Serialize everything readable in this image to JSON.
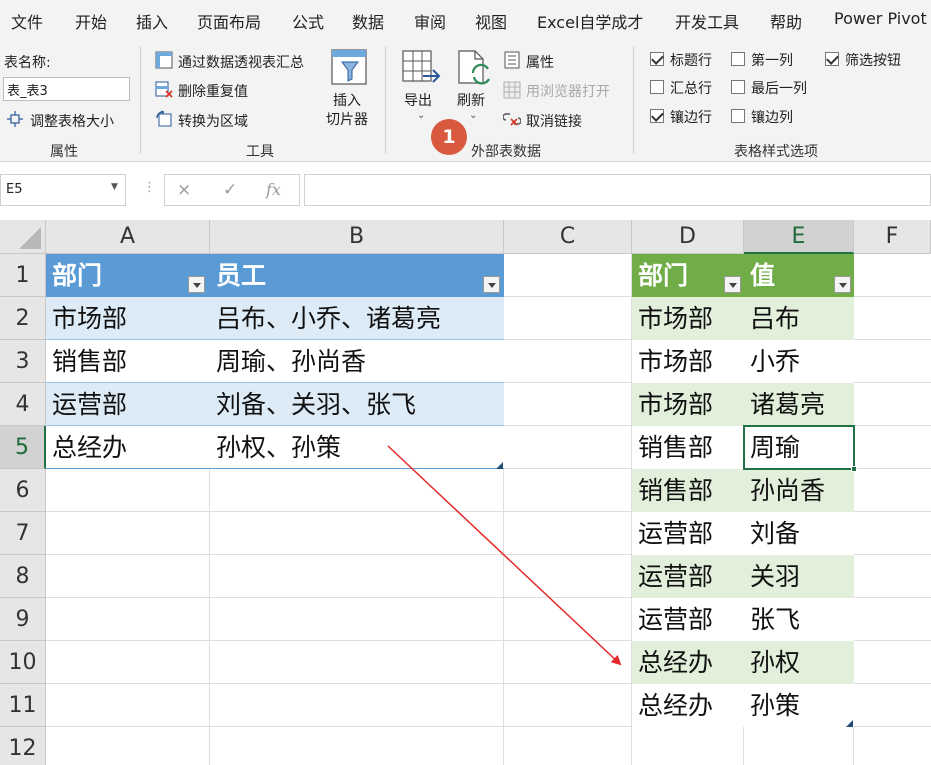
{
  "menu": {
    "tabs": [
      "文件",
      "开始",
      "插入",
      "页面布局",
      "公式",
      "数据",
      "审阅",
      "视图",
      "Excel自学成才",
      "开发工具",
      "帮助",
      "Power Pivot"
    ]
  },
  "ribbon": {
    "properties": {
      "table_name_label": "表名称:",
      "table_name_value": "表_表3",
      "resize_label": "调整表格大小",
      "group_label": "属性"
    },
    "tools": {
      "pivot_label": "通过数据透视表汇总",
      "remove_dup_label": "删除重复值",
      "convert_label": "转换为区域",
      "slicer_label_1": "插入",
      "slicer_label_2": "切片器",
      "group_label": "工具"
    },
    "external": {
      "export_label": "导出",
      "refresh_label": "刷新",
      "properties_label": "属性",
      "open_browser_label": "用浏览器打开",
      "unlink_label": "取消链接",
      "group_label": "外部表数据",
      "badge": "1"
    },
    "style_options": {
      "header_row": "标题行",
      "total_row": "汇总行",
      "banded_rows": "镶边行",
      "first_column": "第一列",
      "last_column": "最后一列",
      "banded_columns": "镶边列",
      "filter_button": "筛选按钮",
      "group_label": "表格样式选项",
      "checked": {
        "header_row": true,
        "total_row": false,
        "banded_rows": true,
        "first_column": false,
        "last_column": false,
        "banded_columns": false,
        "filter_button": true
      }
    }
  },
  "formula_bar": {
    "name_box": "E5",
    "cancel_icon": "×",
    "enter_icon": "✓",
    "fx_icon": "fx",
    "formula": ""
  },
  "grid": {
    "columns": [
      "A",
      "B",
      "C",
      "D",
      "E",
      "F"
    ],
    "rows": [
      "1",
      "2",
      "3",
      "4",
      "5",
      "6",
      "7",
      "8",
      "9",
      "10",
      "11",
      "12"
    ],
    "table1": {
      "headers": [
        "部门",
        "员工"
      ],
      "rows": [
        [
          "市场部",
          "吕布、小乔、诸葛亮"
        ],
        [
          "销售部",
          "周瑜、孙尚香"
        ],
        [
          "运营部",
          "刘备、关羽、张飞"
        ],
        [
          "总经办",
          "孙权、孙策"
        ]
      ]
    },
    "table2": {
      "headers": [
        "部门",
        "值"
      ],
      "rows": [
        [
          "市场部",
          "吕布"
        ],
        [
          "市场部",
          "小乔"
        ],
        [
          "市场部",
          "诸葛亮"
        ],
        [
          "销售部",
          "周瑜"
        ],
        [
          "销售部",
          "孙尚香"
        ],
        [
          "运营部",
          "刘备"
        ],
        [
          "运营部",
          "关羽"
        ],
        [
          "运营部",
          "张飞"
        ],
        [
          "总经办",
          "孙权"
        ],
        [
          "总经办",
          "孙策"
        ]
      ]
    },
    "active_cell": "E5"
  },
  "colors": {
    "table1_header": "#5b9bd5",
    "table1_band": "#ddebf7",
    "table2_header": "#70ad47",
    "table2_band": "#e2efda",
    "arrow": "#e32a2a",
    "badge": "#d9593f"
  }
}
